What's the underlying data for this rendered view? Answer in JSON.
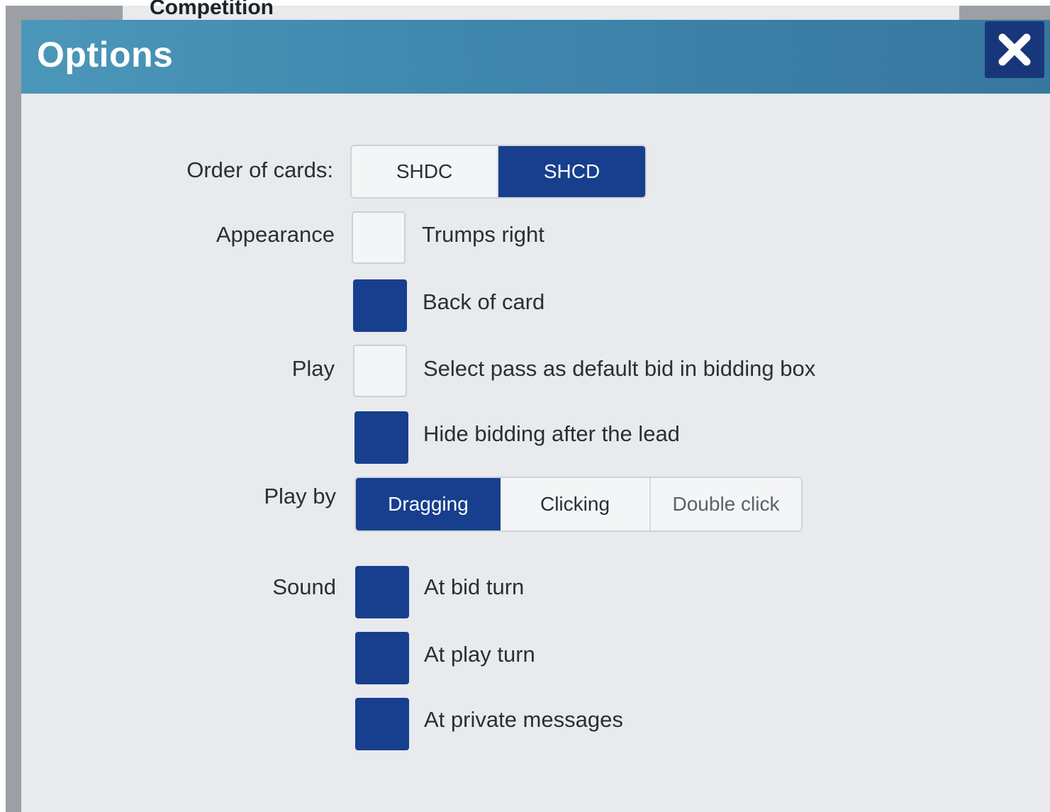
{
  "background_tab": {
    "label": "Competition"
  },
  "dialog": {
    "title": "Options",
    "close_icon": "close-icon"
  },
  "order_of_cards": {
    "label": "Order of cards:",
    "options": [
      "SHDC",
      "SHCD"
    ],
    "selected": "SHCD"
  },
  "appearance": {
    "label": "Appearance",
    "items": [
      {
        "label": "Trumps right",
        "checked": false
      },
      {
        "label": "Back of card",
        "checked": true
      }
    ]
  },
  "play": {
    "label": "Play",
    "items": [
      {
        "label": "Select pass as default bid in bidding box",
        "checked": false
      },
      {
        "label": "Hide bidding after the lead",
        "checked": true
      }
    ]
  },
  "play_by": {
    "label": "Play by",
    "options": [
      "Dragging",
      "Clicking",
      "Double click"
    ],
    "selected": "Dragging"
  },
  "sound": {
    "label": "Sound",
    "items": [
      {
        "label": "At bid turn",
        "checked": true
      },
      {
        "label": "At play turn",
        "checked": true
      },
      {
        "label": "At private messages",
        "checked": true
      }
    ]
  },
  "colors": {
    "titlebar": "#4090b4",
    "accent": "#173f8e",
    "dialog_bg": "#e8eaed"
  }
}
